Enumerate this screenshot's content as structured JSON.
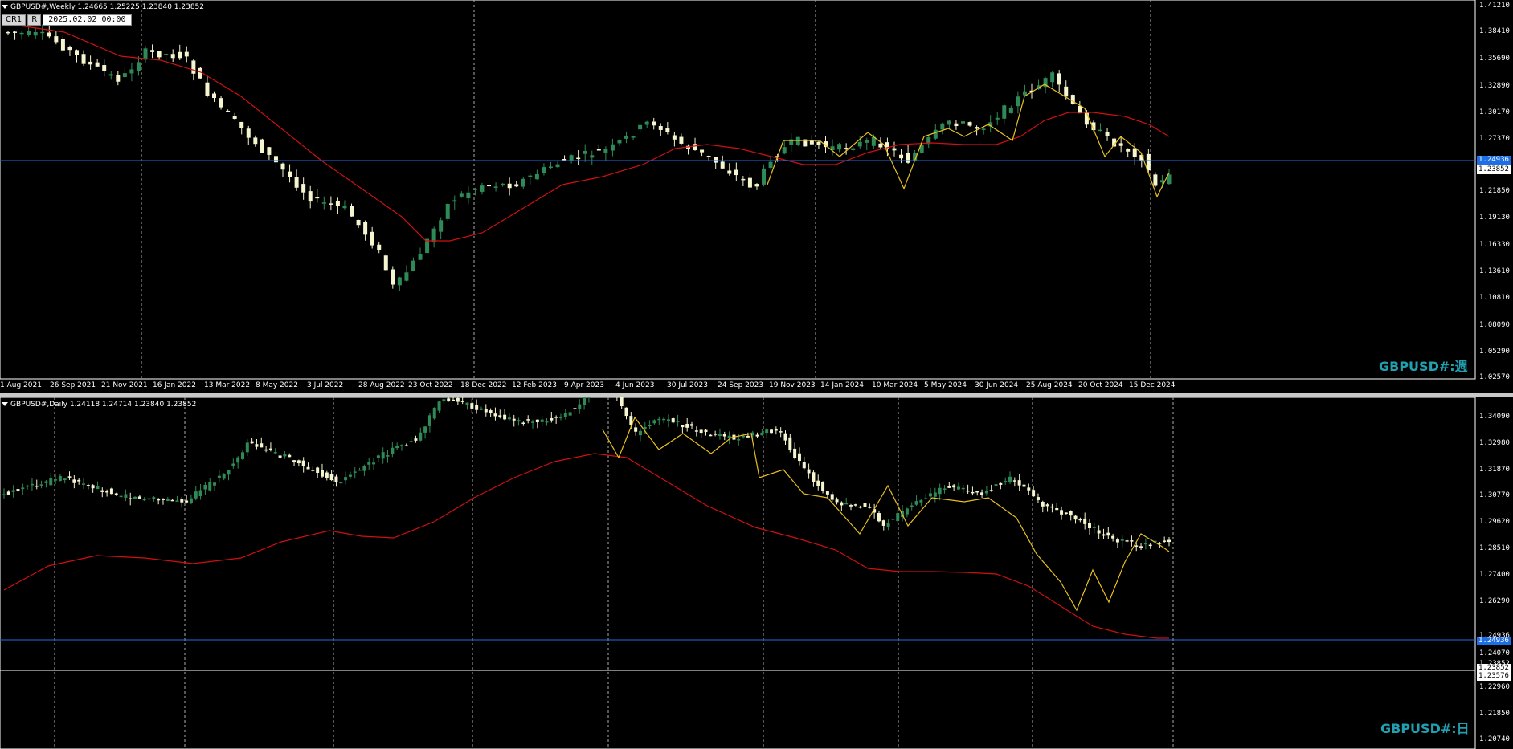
{
  "weekly": {
    "header": "GBPUSD#,Weekly  1.24665 1.25225 1.23840 1.23852",
    "buttons": {
      "cr1": "CR1",
      "r": "R"
    },
    "date_field": "2025.02.02  00:00",
    "watermark": "GBPUSD#:週",
    "price_labels": [
      "1.41210",
      "1.38410",
      "1.35690",
      "1.32890",
      "1.30170",
      "1.27370",
      "1.24936",
      "1.23852",
      "1.21850",
      "1.19130",
      "1.16330",
      "1.13610",
      "1.10810",
      "1.08090",
      "1.05290",
      "1.02570"
    ],
    "current_price_tag": "1.24936",
    "last_price_tag": "1.23852",
    "date_labels": [
      "1 Aug 2021",
      "26 Sep 2021",
      "21 Nov 2021",
      "16 Jan 2022",
      "13 Mar 2022",
      "8 May 2022",
      "3 Jul 2022",
      "28 Aug 2022",
      "23 Oct 2022",
      "18 Dec 2022",
      "12 Feb 2023",
      "9 Apr 2023",
      "4 Jun 2023",
      "30 Jul 2023",
      "24 Sep 2023",
      "19 Nov 2023",
      "14 Jan 2024",
      "10 Mar 2024",
      "5 May 2024",
      "30 Jun 2024",
      "25 Aug 2024",
      "20 Oct 2024",
      "15 Dec 2024"
    ],
    "colors": {
      "bull": "#2e8b57",
      "bear": "#f5f5d0",
      "ma": "#d01010",
      "zigzag": "#e8c020",
      "hline": "#1e6ee6",
      "watermark": "#20a0b0"
    }
  },
  "daily": {
    "header": "GBPUSD#,Daily  1.24118 1.24714 1.23840 1.23852",
    "watermark": "GBPUSD#:日",
    "price_labels": [
      "1.34090",
      "1.32980",
      "1.31870",
      "1.30770",
      "1.29620",
      "1.28510",
      "1.27400",
      "1.26290",
      "1.24936",
      "1.24070",
      "1.23852",
      "1.23576",
      "1.22960",
      "1.21850",
      "1.20740"
    ],
    "current_price_tag": "1.24936",
    "last_price_tag": "1.23852",
    "white_line_tag": "1.23576",
    "colors": {
      "bull": "#2e8b57",
      "bear": "#f5f5d0",
      "ma": "#d01010",
      "zigzag": "#e8c020",
      "hline": "#1e6ee6"
    }
  }
}
